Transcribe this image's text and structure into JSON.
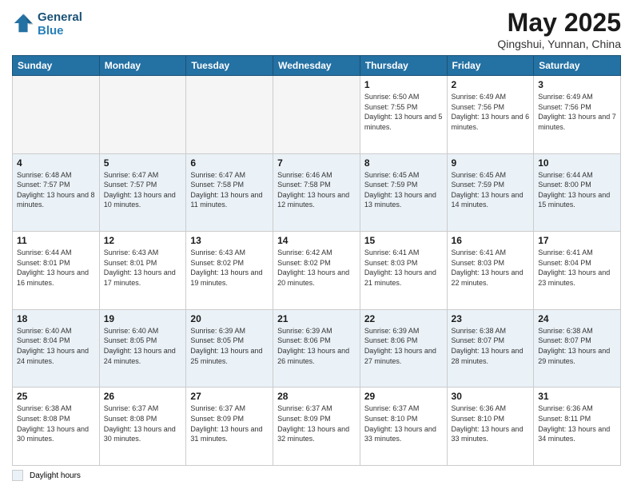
{
  "header": {
    "logo_line1": "General",
    "logo_line2": "Blue",
    "month_title": "May 2025",
    "location": "Qingshui, Yunnan, China"
  },
  "weekdays": [
    "Sunday",
    "Monday",
    "Tuesday",
    "Wednesday",
    "Thursday",
    "Friday",
    "Saturday"
  ],
  "weeks": [
    [
      {
        "day": "",
        "info": ""
      },
      {
        "day": "",
        "info": ""
      },
      {
        "day": "",
        "info": ""
      },
      {
        "day": "",
        "info": ""
      },
      {
        "day": "1",
        "info": "Sunrise: 6:50 AM\nSunset: 7:55 PM\nDaylight: 13 hours and 5 minutes."
      },
      {
        "day": "2",
        "info": "Sunrise: 6:49 AM\nSunset: 7:56 PM\nDaylight: 13 hours and 6 minutes."
      },
      {
        "day": "3",
        "info": "Sunrise: 6:49 AM\nSunset: 7:56 PM\nDaylight: 13 hours and 7 minutes."
      }
    ],
    [
      {
        "day": "4",
        "info": "Sunrise: 6:48 AM\nSunset: 7:57 PM\nDaylight: 13 hours and 8 minutes."
      },
      {
        "day": "5",
        "info": "Sunrise: 6:47 AM\nSunset: 7:57 PM\nDaylight: 13 hours and 10 minutes."
      },
      {
        "day": "6",
        "info": "Sunrise: 6:47 AM\nSunset: 7:58 PM\nDaylight: 13 hours and 11 minutes."
      },
      {
        "day": "7",
        "info": "Sunrise: 6:46 AM\nSunset: 7:58 PM\nDaylight: 13 hours and 12 minutes."
      },
      {
        "day": "8",
        "info": "Sunrise: 6:45 AM\nSunset: 7:59 PM\nDaylight: 13 hours and 13 minutes."
      },
      {
        "day": "9",
        "info": "Sunrise: 6:45 AM\nSunset: 7:59 PM\nDaylight: 13 hours and 14 minutes."
      },
      {
        "day": "10",
        "info": "Sunrise: 6:44 AM\nSunset: 8:00 PM\nDaylight: 13 hours and 15 minutes."
      }
    ],
    [
      {
        "day": "11",
        "info": "Sunrise: 6:44 AM\nSunset: 8:01 PM\nDaylight: 13 hours and 16 minutes."
      },
      {
        "day": "12",
        "info": "Sunrise: 6:43 AM\nSunset: 8:01 PM\nDaylight: 13 hours and 17 minutes."
      },
      {
        "day": "13",
        "info": "Sunrise: 6:43 AM\nSunset: 8:02 PM\nDaylight: 13 hours and 19 minutes."
      },
      {
        "day": "14",
        "info": "Sunrise: 6:42 AM\nSunset: 8:02 PM\nDaylight: 13 hours and 20 minutes."
      },
      {
        "day": "15",
        "info": "Sunrise: 6:41 AM\nSunset: 8:03 PM\nDaylight: 13 hours and 21 minutes."
      },
      {
        "day": "16",
        "info": "Sunrise: 6:41 AM\nSunset: 8:03 PM\nDaylight: 13 hours and 22 minutes."
      },
      {
        "day": "17",
        "info": "Sunrise: 6:41 AM\nSunset: 8:04 PM\nDaylight: 13 hours and 23 minutes."
      }
    ],
    [
      {
        "day": "18",
        "info": "Sunrise: 6:40 AM\nSunset: 8:04 PM\nDaylight: 13 hours and 24 minutes."
      },
      {
        "day": "19",
        "info": "Sunrise: 6:40 AM\nSunset: 8:05 PM\nDaylight: 13 hours and 24 minutes."
      },
      {
        "day": "20",
        "info": "Sunrise: 6:39 AM\nSunset: 8:05 PM\nDaylight: 13 hours and 25 minutes."
      },
      {
        "day": "21",
        "info": "Sunrise: 6:39 AM\nSunset: 8:06 PM\nDaylight: 13 hours and 26 minutes."
      },
      {
        "day": "22",
        "info": "Sunrise: 6:39 AM\nSunset: 8:06 PM\nDaylight: 13 hours and 27 minutes."
      },
      {
        "day": "23",
        "info": "Sunrise: 6:38 AM\nSunset: 8:07 PM\nDaylight: 13 hours and 28 minutes."
      },
      {
        "day": "24",
        "info": "Sunrise: 6:38 AM\nSunset: 8:07 PM\nDaylight: 13 hours and 29 minutes."
      }
    ],
    [
      {
        "day": "25",
        "info": "Sunrise: 6:38 AM\nSunset: 8:08 PM\nDaylight: 13 hours and 30 minutes."
      },
      {
        "day": "26",
        "info": "Sunrise: 6:37 AM\nSunset: 8:08 PM\nDaylight: 13 hours and 30 minutes."
      },
      {
        "day": "27",
        "info": "Sunrise: 6:37 AM\nSunset: 8:09 PM\nDaylight: 13 hours and 31 minutes."
      },
      {
        "day": "28",
        "info": "Sunrise: 6:37 AM\nSunset: 8:09 PM\nDaylight: 13 hours and 32 minutes."
      },
      {
        "day": "29",
        "info": "Sunrise: 6:37 AM\nSunset: 8:10 PM\nDaylight: 13 hours and 33 minutes."
      },
      {
        "day": "30",
        "info": "Sunrise: 6:36 AM\nSunset: 8:10 PM\nDaylight: 13 hours and 33 minutes."
      },
      {
        "day": "31",
        "info": "Sunrise: 6:36 AM\nSunset: 8:11 PM\nDaylight: 13 hours and 34 minutes."
      }
    ]
  ],
  "legend": {
    "box_label": "Daylight hours"
  }
}
